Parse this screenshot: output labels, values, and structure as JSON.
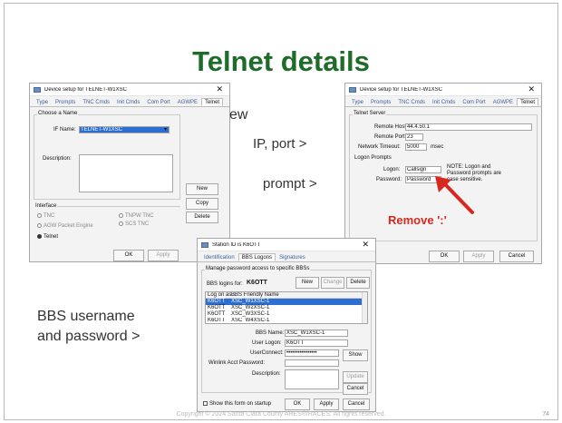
{
  "slide": {
    "title": "Telnet details",
    "labels": {
      "new": "ew",
      "ip_port": "IP, port >",
      "prompt": "prompt >",
      "bbs_line1": "BBS username",
      "bbs_line2": "and password >"
    },
    "footer": "Copyright © 2024 Santa Clara County ARES®/RACES.  All rights reserved.",
    "page_number": "74",
    "annotation": "Remove ':'",
    "annotation_color": "#d6281f",
    "title_color": "#1e6b2a"
  },
  "dialog1": {
    "title": "Device setup for TELNET-W1XSC",
    "tabs": [
      "Type",
      "Prompts",
      "TNC Cmds",
      "Init Cmds",
      "Com Port",
      "AGWPE",
      "Telnet"
    ],
    "active_tab": "Telnet",
    "choose_name_label": "Choose a Name",
    "if_name_label": "IF Name:",
    "if_name_value": "TELNET-W1XSC",
    "description_label": "Description:",
    "interface_label": "Interface",
    "radios": [
      "TNC",
      "TNPW TNC",
      "AGW Packet Engine",
      "SCS TNC",
      "Telnet"
    ],
    "selected_radio": "Telnet",
    "buttons": [
      "New",
      "Copy",
      "Delete"
    ],
    "ok": "OK",
    "apply": "Apply"
  },
  "dialog2": {
    "title": "Device setup for TELNET-W1XSC",
    "tabs": [
      "Type",
      "Prompts",
      "TNC Cmds",
      "Init Cmds",
      "Com Port",
      "AGWPE",
      "Telnet"
    ],
    "active_tab": "Telnet",
    "server_label": "Telnet Server",
    "remote_host_label": "Remote Host:",
    "remote_host_value": "44.4.50.1",
    "remote_port_label": "Remote Port:",
    "remote_port_value": "23",
    "network_timeout_label": "Network Timeout:",
    "network_timeout_value": "5000",
    "msec": "msec",
    "logon_prompts_label": "Logon Prompts",
    "logon_label": "Logon:",
    "logon_value": "Callsign",
    "password_label": "Password:",
    "password_value": "Password",
    "note": "NOTE: Logon and Password prompts are case sensitive.",
    "ok": "OK",
    "apply": "Apply",
    "cancel": "Cancel"
  },
  "dialog3": {
    "title": "Station ID is K6OTT",
    "tabs": [
      "Identification",
      "BBS Logons",
      "Signatures"
    ],
    "active_tab": "BBS Logons",
    "group_label": "Manage password access to specific BBSs",
    "bbs_logins_for": "BBS logins for:",
    "callsign": "K6OTT",
    "buttons": [
      "New",
      "Change",
      "Delete"
    ],
    "list_headers": [
      "Log on as...",
      "BBS Friendly Name"
    ],
    "list_rows": [
      [
        "K6OTT",
        "XSC_W1XSC-1"
      ],
      [
        "K6OTT",
        "XSC_W2XSC-1"
      ],
      [
        "K6OTT",
        "XSC_W3XSC-1"
      ],
      [
        "K6OTT",
        "XSC_W4XSC-1"
      ]
    ],
    "bbs_name_label": "BBS Name:",
    "bbs_name_value": "XSC_W1XSC-1",
    "user_logon_label": "User Logon:",
    "user_logon_value": "K6OTT",
    "user_connect_label": "UserConnect:",
    "user_connect_value": "••••••••••••••••",
    "show": "Show",
    "winlink_label": "Winlink Acct Password:",
    "description_label": "Description:",
    "update": "Update",
    "cancel_inner": "Cancel",
    "show_on_startup": "Show this form on startup",
    "ok": "OK",
    "apply": "Apply",
    "cancel": "Cancel"
  }
}
